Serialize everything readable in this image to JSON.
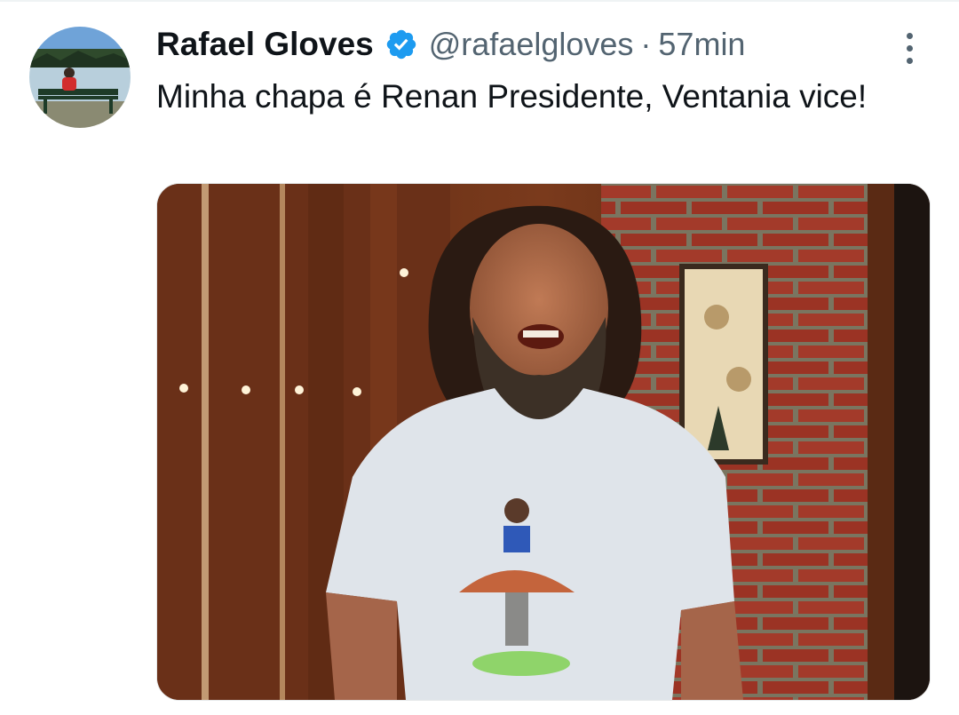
{
  "tweet": {
    "author_name": "Rafael Gloves",
    "handle": "@rafaelgloves",
    "separator": "·",
    "time": "57min",
    "text": "Minha chapa é Renan Presidente, Ventania vice!",
    "verified": true
  },
  "icons": {
    "verified": "verified-badge-icon",
    "more": "more-options-icon"
  },
  "colors": {
    "text_primary": "#0f1419",
    "text_secondary": "#536471",
    "verified_blue": "#1d9bf0"
  }
}
